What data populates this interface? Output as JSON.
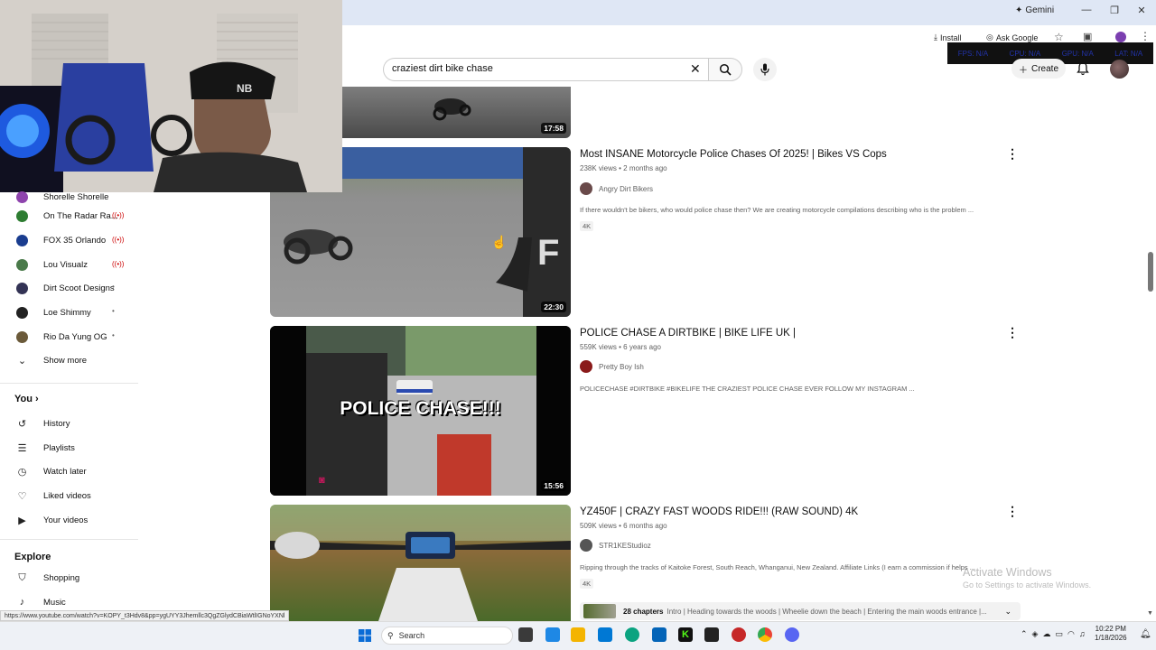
{
  "browser": {
    "gemini_label": "Gemini",
    "install_label": "Install",
    "ask_google_label": "Ask Google",
    "overlay_labels": [
      "FPS: N/A",
      "CPU: N/A",
      "GPU: N/A",
      "LAT: N/A"
    ]
  },
  "youtube_header": {
    "search_query": "craziest dirt bike chase",
    "create_label": "Create"
  },
  "sidebar": {
    "subscriptions": [
      {
        "name": "Shorelle Shorelle",
        "color": "#8e44ad",
        "indicator": "live"
      },
      {
        "name": "On The Radar Ra...",
        "color": "#2e7d32",
        "indicator": "live"
      },
      {
        "name": "FOX 35 Orlando",
        "color": "#1a3d8f",
        "indicator": "live"
      },
      {
        "name": "Lou Visualz",
        "color": "#4a7a4a",
        "indicator": "live"
      },
      {
        "name": "Dirt Scoot Designs",
        "color": "#333355",
        "indicator": "dot"
      },
      {
        "name": "Loe Shimmy",
        "color": "#222222",
        "indicator": "dot"
      },
      {
        "name": "Rio Da Yung OG",
        "color": "#6b5a3a",
        "indicator": "dot"
      }
    ],
    "show_more_label": "Show more",
    "you_label": "You",
    "you_items": [
      {
        "icon": "history-icon",
        "label": "History"
      },
      {
        "icon": "playlists-icon",
        "label": "Playlists"
      },
      {
        "icon": "watch-later-icon",
        "label": "Watch later"
      },
      {
        "icon": "liked-videos-icon",
        "label": "Liked videos"
      },
      {
        "icon": "your-videos-icon",
        "label": "Your videos"
      }
    ],
    "explore_label": "Explore",
    "explore_items": [
      {
        "icon": "shopping-icon",
        "label": "Shopping"
      },
      {
        "icon": "music-icon",
        "label": "Music"
      }
    ]
  },
  "videos": [
    {
      "duration": "17:58"
    },
    {
      "title": "Most INSANE Motorcycle Police Chases Of 2025! | Bikes VS Cops",
      "meta": "238K views • 2 months ago",
      "channel": "Angry Dirt Bikers",
      "description": "If there wouldn't be bikers, who would police chase then? We are creating motorcycle compilations describing who is the problem ...",
      "badge": "4K",
      "duration": "22:30"
    },
    {
      "title": "POLICE CHASE A DIRTBIKE | BIKE LIFE UK |",
      "meta": "559K views • 6 years ago",
      "channel": "Pretty Boy Ish",
      "description": "POLICECHASE #DIRTBIKE #BIKELIFE THE CRAZIEST POLICE CHASE EVER FOLLOW MY INSTAGRAM ...",
      "thumb_text": "POLICE CHASE!!!",
      "duration": "15:56"
    },
    {
      "title": "YZ450F | CRAZY FAST WOODS RIDE!!! (RAW SOUND) 4K",
      "meta": "509K views • 6 months ago",
      "channel": "STR1KEStudioz",
      "description": "Ripping through the tracks of Kaitoke Forest, South Reach, Whanganui, New Zealand. Affiliate Links (I earn a commission if helps ...",
      "badge": "4K",
      "chapters": "28 chapters",
      "chapters_text": "Intro | Heading towards the woods | Wheelie down the beach | Entering the main woods entrance |..."
    }
  ],
  "status_url": "https://www.youtube.com/watch?v=KOPY_t3Hdv8&pp=ygUYY3Jhemllc3QgZGlydCBiaWtlIGNoYXNl",
  "watermark": {
    "line1": "Activate Windows",
    "line2": "Go to Settings to activate Windows."
  },
  "taskbar": {
    "search_label": "Search",
    "time": "10:22 PM",
    "date": "1/18/2026"
  }
}
